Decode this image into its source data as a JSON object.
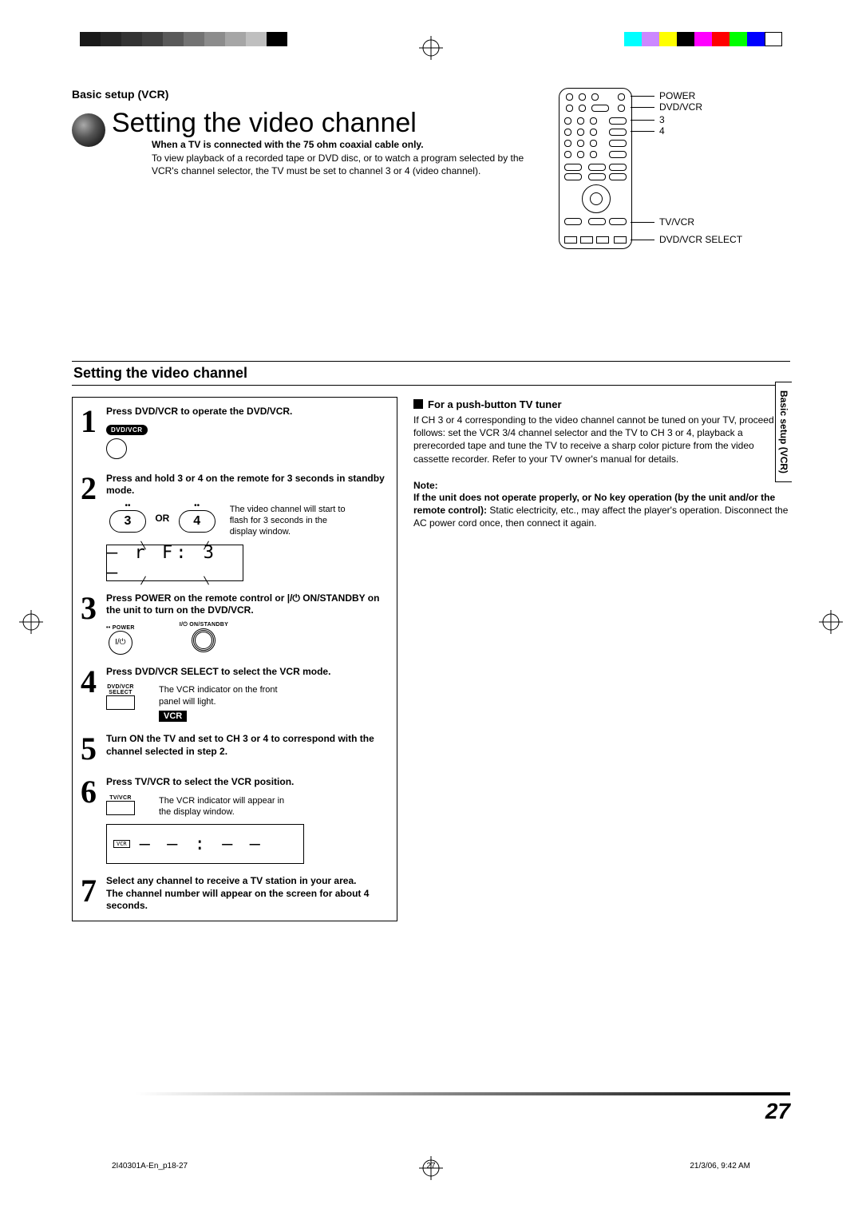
{
  "header": {
    "section": "Basic setup (VCR)"
  },
  "title": "Setting the video channel",
  "intro": {
    "bold_line": "When a TV is connected with the 75 ohm coaxial cable only.",
    "body": "To view playback of a recorded tape or DVD disc, or to watch a program selected by the VCR's channel selector, the TV must be set to channel 3 or 4 (video channel)."
  },
  "remote_labels": {
    "power": "POWER",
    "dvdvcr": "DVD/VCR",
    "three": "3",
    "four": "4",
    "tvvcr": "TV/VCR",
    "select": "DVD/VCR SELECT"
  },
  "band_heading": "Setting the video channel",
  "steps": [
    {
      "num": "1",
      "head": "Press DVD/VCR to operate the DVD/VCR.",
      "pill": "DVD/VCR"
    },
    {
      "num": "2",
      "head": "Press and hold 3 or 4 on the remote for 3 seconds in standby mode.",
      "sub": "The video channel will start to flash for 3 seconds in the display window.",
      "buttons": {
        "left": "3",
        "or": "OR",
        "right": "4"
      },
      "lcd": "– r F:  3 –"
    },
    {
      "num": "3",
      "head": "Press POWER on the remote control or  |/⏻  ON/STANDBY on the unit to turn on the DVD/VCR.",
      "btn_labels": {
        "power_dots": "•• POWER",
        "power_sym": "I/⏻",
        "standby": "I/⏻  ON/STANDBY"
      }
    },
    {
      "num": "4",
      "head": "Press DVD/VCR SELECT to select the VCR mode.",
      "sub": "The VCR indicator on the front panel will light.",
      "key_label": "DVD/VCR\nSELECT",
      "vcr_badge": "VCR"
    },
    {
      "num": "5",
      "head": "Turn ON the TV and set to CH 3 or 4 to correspond with the channel selected in step 2."
    },
    {
      "num": "6",
      "head": "Press TV/VCR to select the VCR position.",
      "sub": "The VCR indicator will appear in the display window.",
      "key_label": "TV/VCR",
      "display": {
        "tag": "VCR",
        "seg": "–  – : –  –"
      }
    },
    {
      "num": "7",
      "head": "Select any channel to receive a TV station in your area.",
      "head2": "The channel number will appear on the screen for about 4 seconds."
    }
  ],
  "right": {
    "subhead": "For a push-button TV tuner",
    "para": "If CH 3 or 4 corresponding to the video channel cannot be tuned on your TV, proceed as follows: set the VCR 3/4 channel selector and the TV to CH 3 or 4, playback a prerecorded tape and tune the TV to receive a sharp color picture from the video cassette recorder. Refer to your TV owner's manual for details.",
    "note_head": "Note:",
    "note_bold": "If the unit does not operate properly, or No key operation (by the unit and/or the remote control):",
    "note_rest": " Static electricity, etc., may affect the player's operation. Disconnect the AC power cord once, then connect it again."
  },
  "side_tab": "Basic setup (VCR)",
  "page_number": "27",
  "footer": {
    "file": "2I40301A-En_p18-27",
    "page": "27",
    "timestamp": "21/3/06, 9:42 AM"
  }
}
